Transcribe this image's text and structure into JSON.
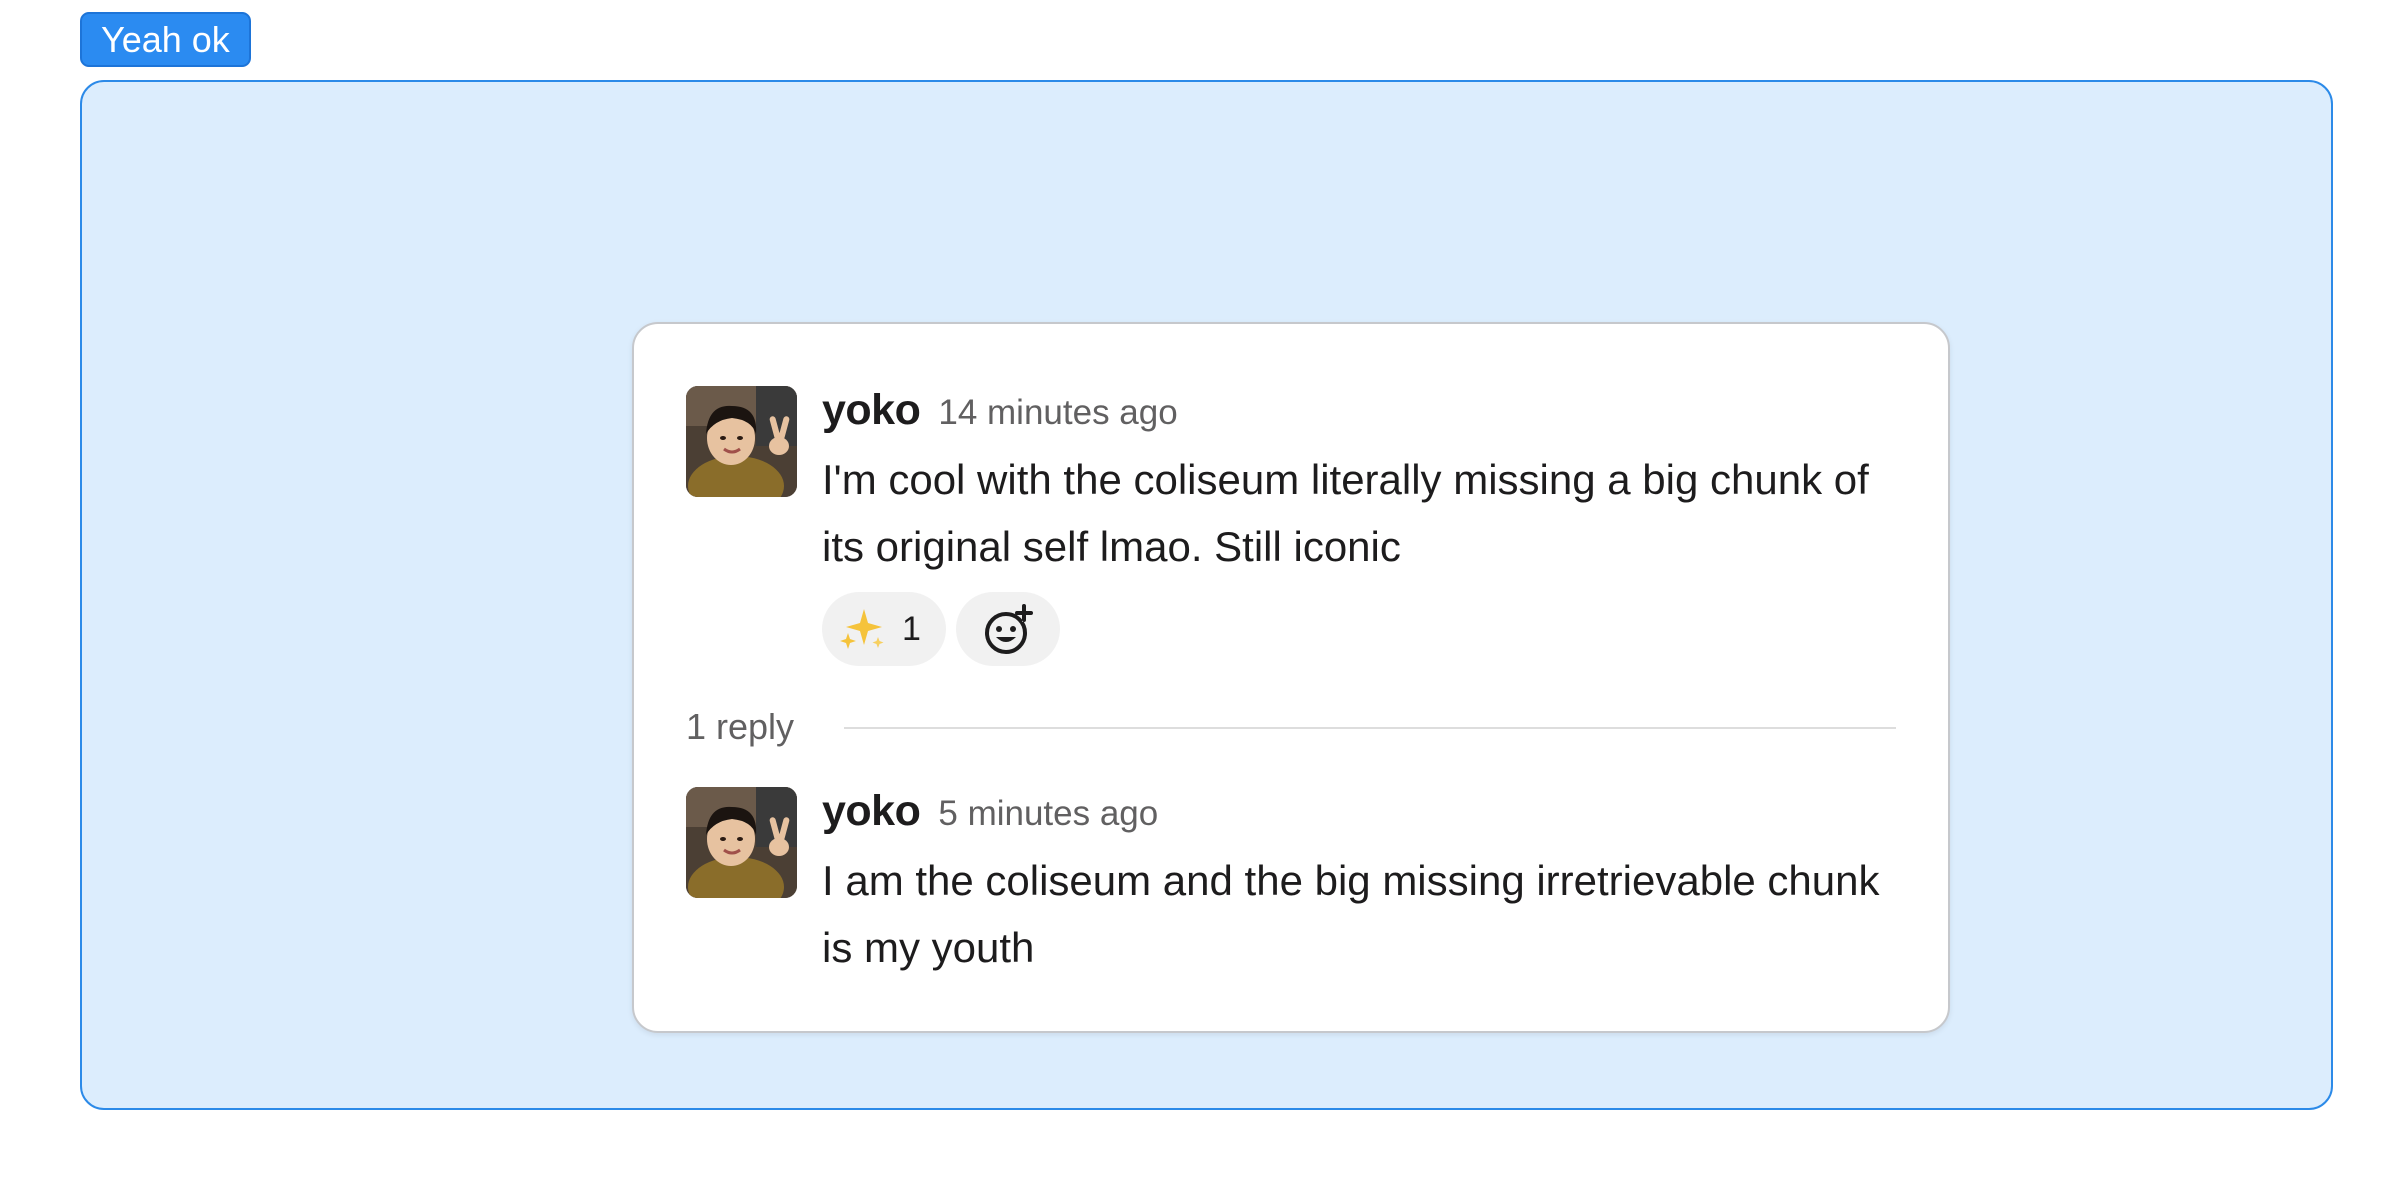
{
  "tag": {
    "label": "Yeah ok"
  },
  "thread": {
    "parent": {
      "username": "yoko",
      "timestamp": "14 minutes ago",
      "text": "I'm cool with the coliseum literally missing a big chunk of its original self lmao. Still iconic",
      "reactions": [
        {
          "emoji": "sparkles-icon",
          "count": "1"
        }
      ],
      "add_reaction_icon": "add-reaction-icon"
    },
    "reply_count": "1 reply",
    "reply": {
      "username": "yoko",
      "timestamp": "5 minutes ago",
      "text": "I am the coliseum and the big missing irretrievable chunk is my youth"
    }
  },
  "colors": {
    "tag_bg": "#2b8bf1",
    "frame_bg": "#dcedfd",
    "frame_border": "#2c8ae8",
    "sparkle": "#f5c33b"
  }
}
